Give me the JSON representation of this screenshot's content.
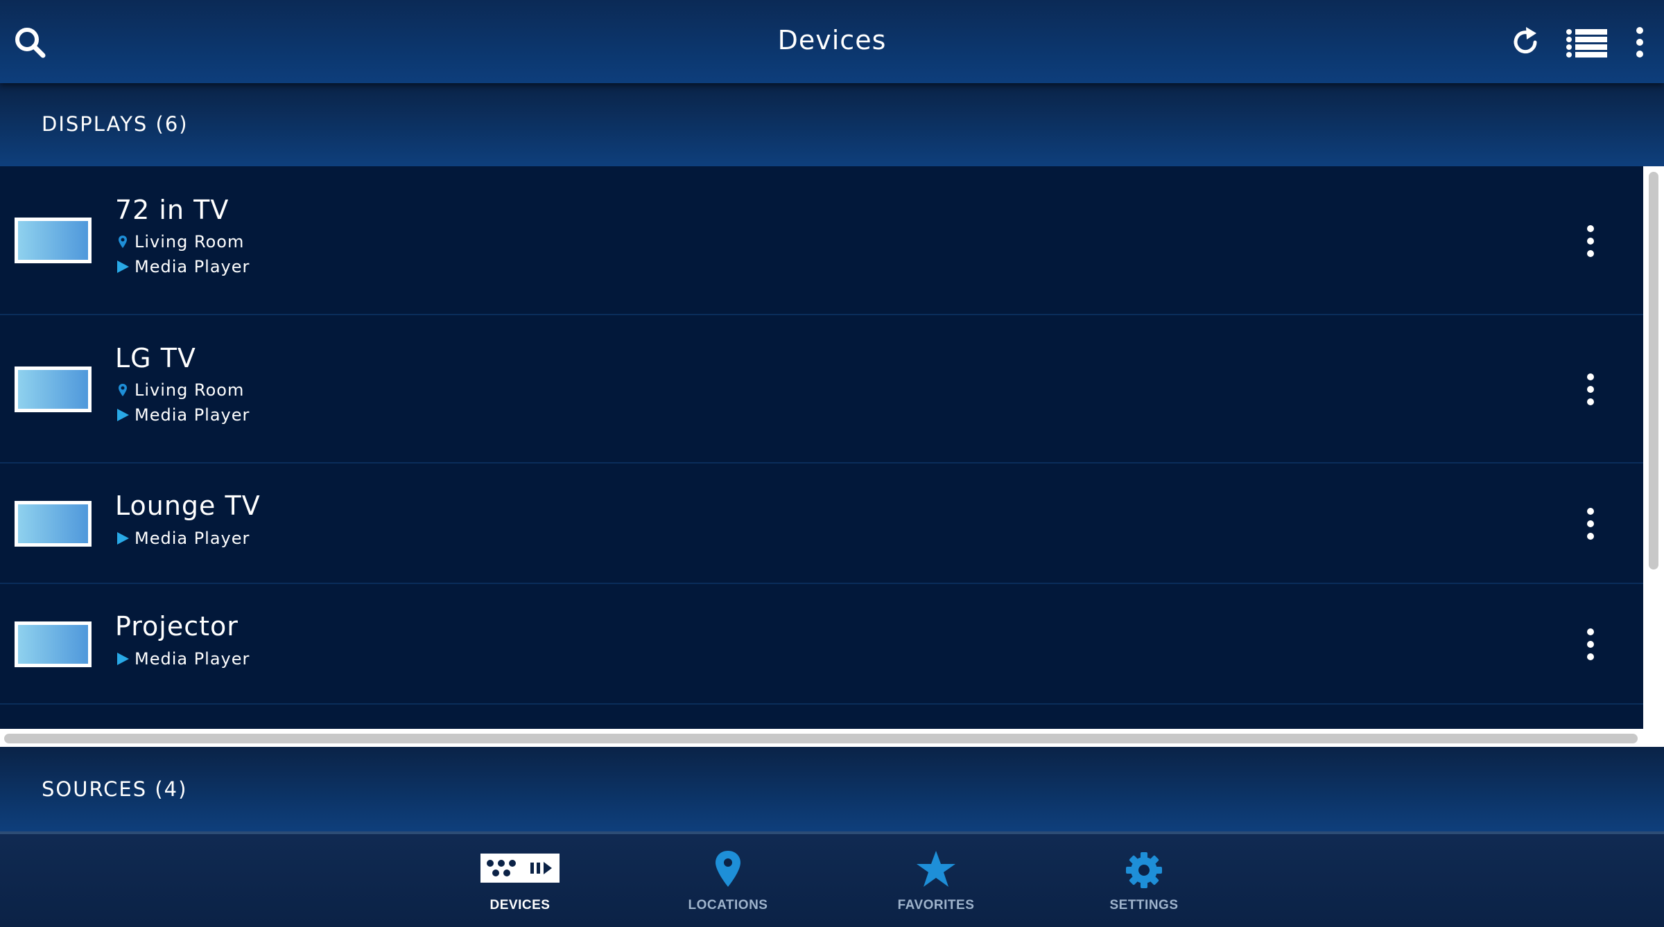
{
  "header": {
    "title": "Devices"
  },
  "sections": {
    "displays_label": "DISPLAYS (6)",
    "sources_label": "SOURCES (4)"
  },
  "devices": [
    {
      "name": "72 in TV",
      "location": "Living Room",
      "type": "Media Player"
    },
    {
      "name": "LG TV",
      "location": "Living Room",
      "type": "Media Player"
    },
    {
      "name": "Lounge TV",
      "type": "Media Player"
    },
    {
      "name": "Projector",
      "type": "Media Player"
    }
  ],
  "nav": {
    "items": [
      {
        "label": "DEVICES",
        "icon": "devices-icon",
        "active": true
      },
      {
        "label": "LOCATIONS",
        "icon": "location-pin-icon",
        "active": false
      },
      {
        "label": "FAVORITES",
        "icon": "star-icon",
        "active": false
      },
      {
        "label": "SETTINGS",
        "icon": "gear-icon",
        "active": false
      }
    ]
  },
  "colors": {
    "accent": "#1e8fd8",
    "play": "#29a9e6",
    "list_bg": "#02183a",
    "header_bg": "#0d3e7c"
  }
}
